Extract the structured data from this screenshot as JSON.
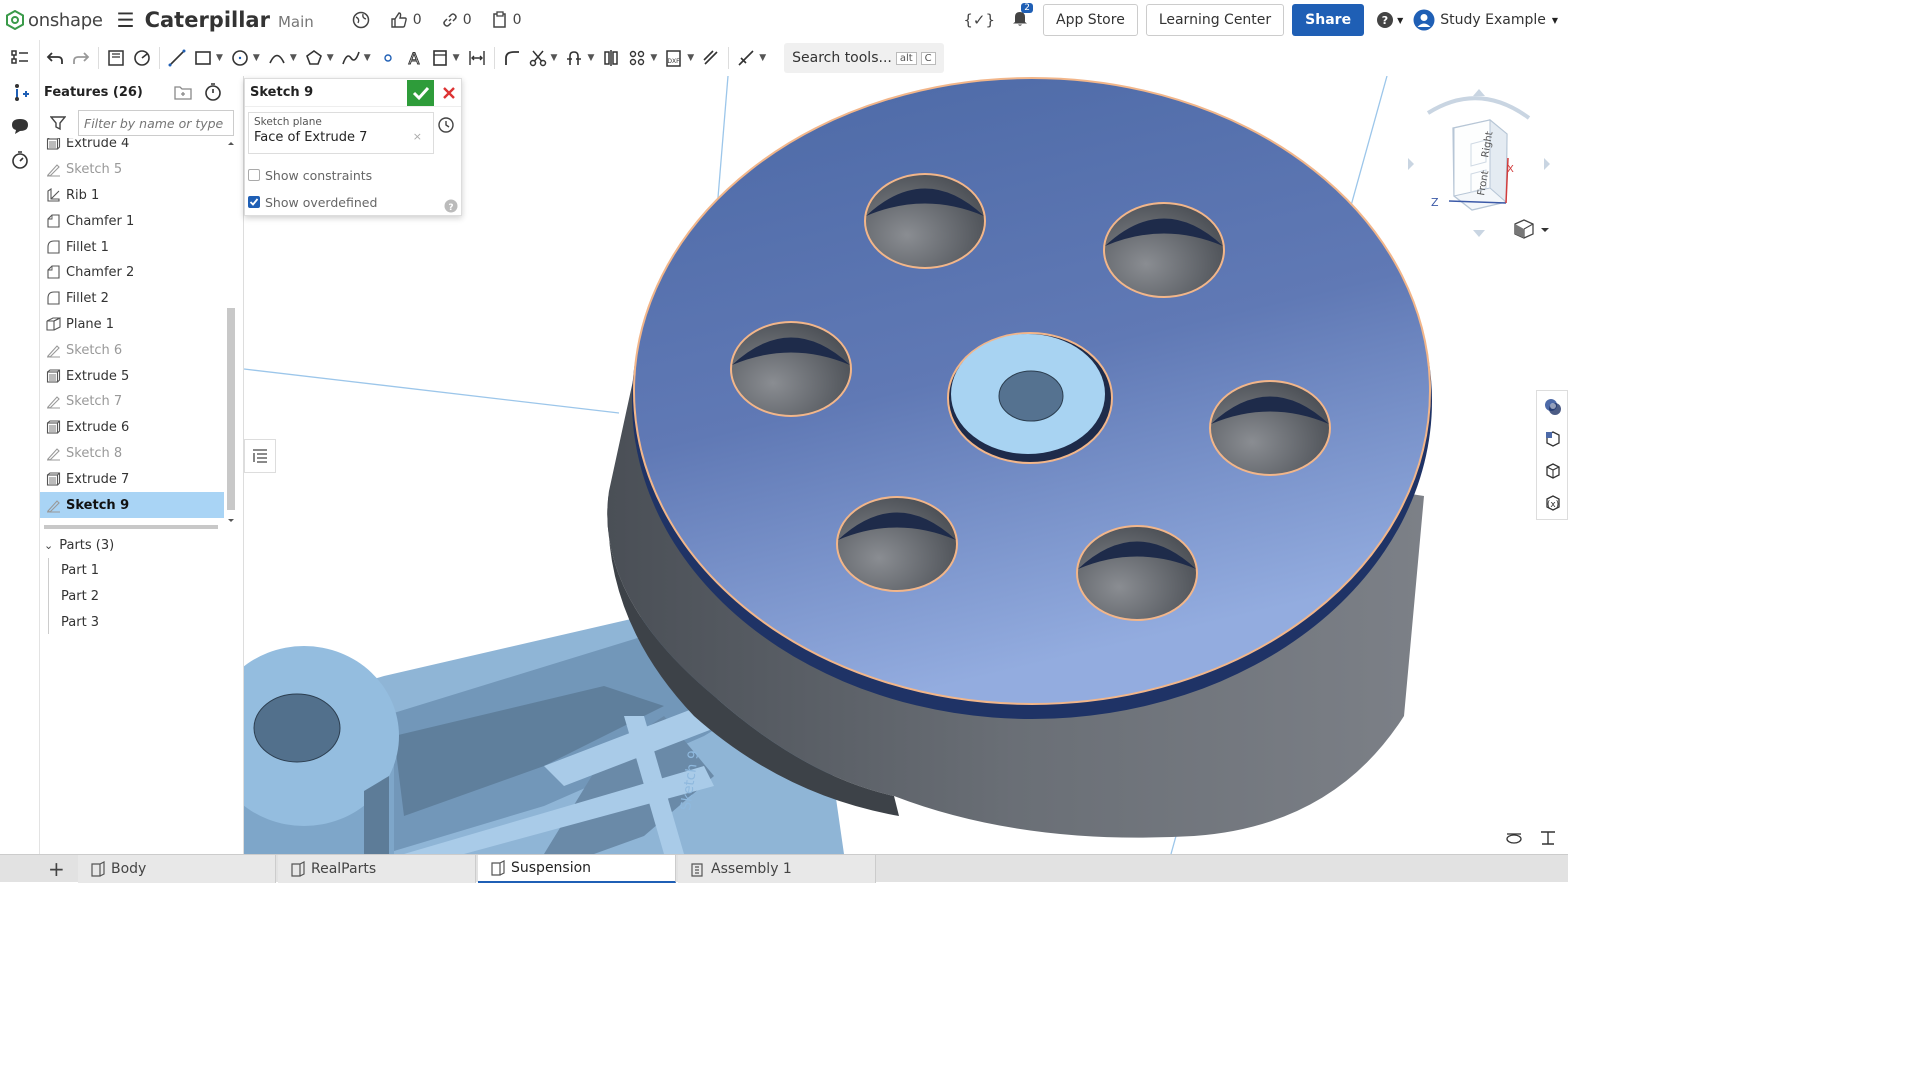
{
  "app": {
    "logo_text": "onshape",
    "doc_title": "Caterpillar",
    "branch": "Main",
    "likes": "0",
    "links": "0",
    "copies": "0",
    "notification_count": "2",
    "app_store": "App Store",
    "learning_center": "Learning Center",
    "share": "Share",
    "user": "Study Example"
  },
  "toolbar": {
    "search_label": "Search tools...",
    "shortcut_alt": "alt",
    "shortcut_key": "C"
  },
  "features": {
    "title": "Features (26)",
    "filter_placeholder": "Filter by name or type",
    "items": [
      {
        "label": "Extrude 4",
        "type": "extrude",
        "dim": false,
        "selected": false
      },
      {
        "label": "Sketch 5",
        "type": "sketch",
        "dim": true,
        "selected": false
      },
      {
        "label": "Rib 1",
        "type": "rib",
        "dim": false,
        "selected": false
      },
      {
        "label": "Chamfer 1",
        "type": "chamfer",
        "dim": false,
        "selected": false
      },
      {
        "label": "Fillet 1",
        "type": "fillet",
        "dim": false,
        "selected": false
      },
      {
        "label": "Chamfer 2",
        "type": "chamfer",
        "dim": false,
        "selected": false
      },
      {
        "label": "Fillet 2",
        "type": "fillet",
        "dim": false,
        "selected": false
      },
      {
        "label": "Plane 1",
        "type": "plane",
        "dim": false,
        "selected": false
      },
      {
        "label": "Sketch 6",
        "type": "sketch",
        "dim": true,
        "selected": false
      },
      {
        "label": "Extrude 5",
        "type": "extrude",
        "dim": false,
        "selected": false
      },
      {
        "label": "Sketch 7",
        "type": "sketch",
        "dim": true,
        "selected": false
      },
      {
        "label": "Extrude 6",
        "type": "extrude",
        "dim": false,
        "selected": false
      },
      {
        "label": "Sketch 8",
        "type": "sketch",
        "dim": true,
        "selected": false
      },
      {
        "label": "Extrude 7",
        "type": "extrude",
        "dim": false,
        "selected": false
      },
      {
        "label": "Sketch 9",
        "type": "sketch",
        "dim": false,
        "selected": true
      }
    ],
    "parts_label": "Parts (3)",
    "parts": [
      "Part 1",
      "Part 2",
      "Part 3"
    ]
  },
  "sketch_dialog": {
    "title": "Sketch 9",
    "plane_label": "Sketch plane",
    "plane_value": "Face of Extrude 7",
    "show_constraints": "Show constraints",
    "show_overdefined": "Show overdefined",
    "show_constraints_checked": false,
    "show_overdefined_checked": true
  },
  "viewport": {
    "sketch_label": "Sketch 9",
    "cube_right": "Right",
    "cube_front": "Front",
    "axis_x": "X",
    "axis_z": "Z"
  },
  "tabs": [
    {
      "label": "Body",
      "active": false
    },
    {
      "label": "RealParts",
      "active": false
    },
    {
      "label": "Suspension",
      "active": true
    },
    {
      "label": "Assembly 1",
      "active": false
    }
  ]
}
